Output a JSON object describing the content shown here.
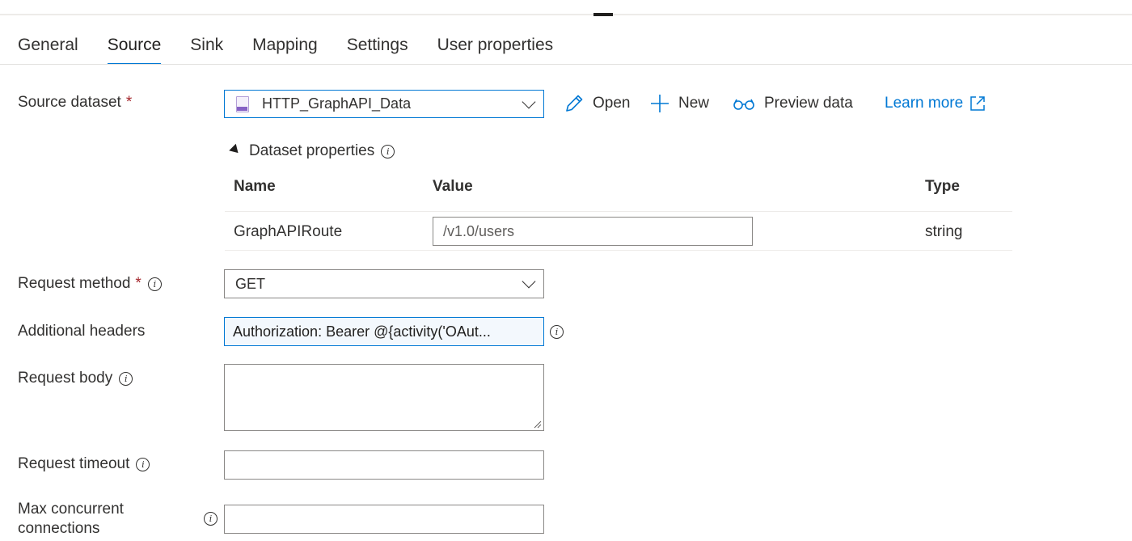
{
  "tabs": [
    {
      "label": "General",
      "active": false
    },
    {
      "label": "Source",
      "active": true
    },
    {
      "label": "Sink",
      "active": false
    },
    {
      "label": "Mapping",
      "active": false
    },
    {
      "label": "Settings",
      "active": false
    },
    {
      "label": "User properties",
      "active": false
    }
  ],
  "source_dataset": {
    "label": "Source dataset",
    "required_mark": "*",
    "value": "HTTP_GraphAPI_Data",
    "icon": "json-dataset-icon",
    "actions": {
      "open": "Open",
      "new": "New",
      "preview": "Preview data",
      "learn_more": "Learn more"
    }
  },
  "dataset_properties": {
    "title": "Dataset properties",
    "columns": {
      "name": "Name",
      "value": "Value",
      "type": "Type"
    },
    "rows": [
      {
        "name": "GraphAPIRoute",
        "value": "/v1.0/users",
        "type": "string"
      }
    ]
  },
  "request_method": {
    "label": "Request method",
    "required_mark": "*",
    "value": "GET"
  },
  "additional_headers": {
    "label": "Additional headers",
    "value": "Authorization: Bearer @{activity('OAut..."
  },
  "request_body": {
    "label": "Request body",
    "value": ""
  },
  "request_timeout": {
    "label": "Request timeout",
    "value": ""
  },
  "max_concurrent": {
    "label_line1": "Max concurrent",
    "label_line2": "connections",
    "value": ""
  },
  "colors": {
    "accent": "#0078d4",
    "required": "#a4262c",
    "text": "#323130"
  }
}
